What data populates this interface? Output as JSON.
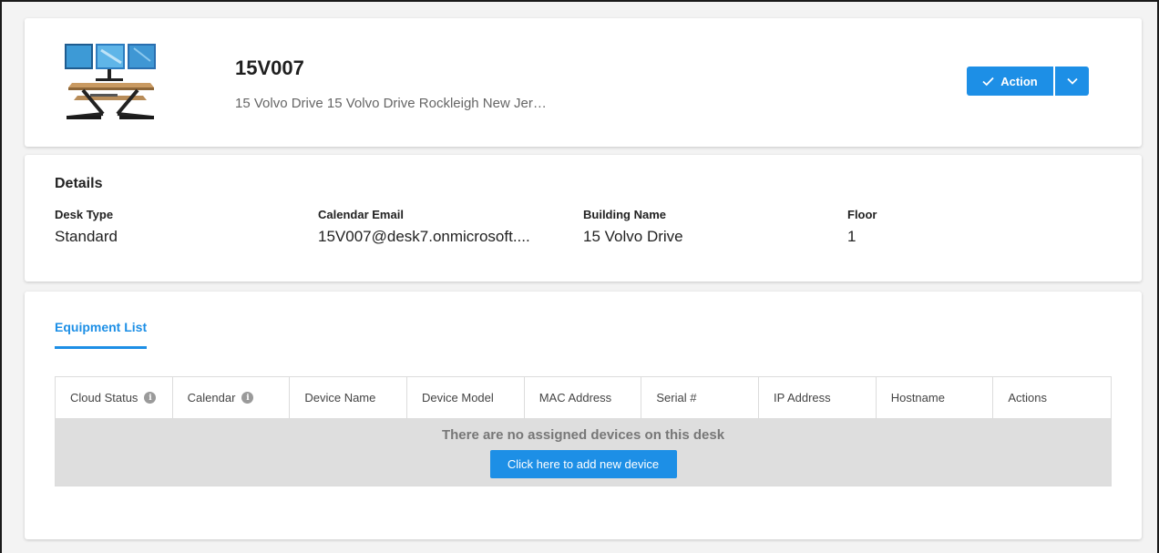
{
  "desk": {
    "title": "15V007",
    "address": "15 Volvo Drive 15 Volvo Drive Rockleigh New Jer…",
    "image_icon": "standing-desk-with-monitors"
  },
  "action": {
    "label": "Action",
    "check_icon": "check-icon",
    "dropdown_icon": "chevron-down-icon"
  },
  "details": {
    "title": "Details",
    "fields": [
      {
        "label": "Desk Type",
        "value": "Standard"
      },
      {
        "label": "Calendar Email",
        "value": "15V007@desk7.onmicrosoft...."
      },
      {
        "label": "Building Name",
        "value": "15 Volvo Drive"
      },
      {
        "label": "Floor",
        "value": "1"
      }
    ]
  },
  "equipment": {
    "tab_label": "Equipment List",
    "columns": [
      "Cloud Status",
      "Calendar",
      "Device Name",
      "Device Model",
      "MAC Address",
      "Serial #",
      "IP Address",
      "Hostname",
      "Actions"
    ],
    "info_icon_text": "i",
    "empty_message": "There are no assigned devices on this desk",
    "add_button_label": "Click here to add new device"
  },
  "colors": {
    "accent": "#1d8fe6",
    "empty_row_bg": "#dedede"
  }
}
